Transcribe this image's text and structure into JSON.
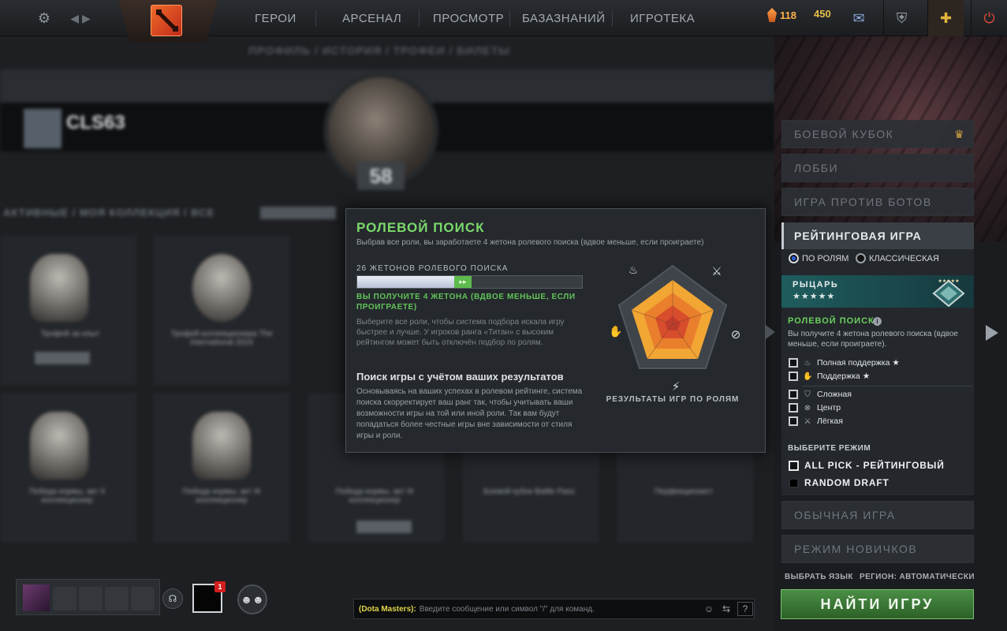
{
  "topbar": {
    "nav": [
      "ГЕРОИ",
      "АРСЕНАЛ",
      "ПРОСМОТР",
      "БАЗАЗНАНИЙ",
      "ИГРОТЕКА"
    ],
    "shards": "118",
    "gold": "450",
    "icons": [
      "gear-icon",
      "back-forward-icon",
      "dota-logo",
      "mail-icon",
      "armory-icon",
      "plus-icon",
      "power-icon"
    ]
  },
  "background": {
    "subnav": "ПРОФИЛЬ / ИСТОРИЯ / ТРОФЕИ / БИЛЕТЫ",
    "player_name": "CLS63",
    "level": "58",
    "filters": "АКТИВНЫЕ / МОЯ КОЛЛЕКЦИЯ / ВСЕ",
    "cards": [
      "Трофей за опыт",
      "Трофей коллекционера The International 2024",
      "Победа кормы, акт II коллекционер",
      "Победа кормы, акт III коллекционер",
      "Победа кормы, акт III коллекционер",
      "Боевой кубок Battle Pass",
      "Перфекционист"
    ]
  },
  "popup": {
    "title": "РОЛЕВОЙ ПОИСК",
    "subtitle": "Выбрав все роли, вы заработаете 4 жетона ролевого поиска (вдвое меньше, если проиграете)",
    "tokens_label": "26 ЖЕТОНОВ РОЛЕВОГО ПОИСКА",
    "progress_current": 0.43,
    "progress_gain": 0.08,
    "gain_text": "ВЫ ПОЛУЧИТЕ 4 ЖЕТОНА (ВДВОЕ МЕНЬШЕ, ЕСЛИ ПРОИГРАЕТЕ)",
    "desc": "Выберите все роли, чтобы система подбора искала игру быстрее и лучше. У игроков ранга «Титан» с высоким рейтингом может быть отключён подбор по ролям.",
    "heading2": "Поиск игры с учётом ваших результатов",
    "desc2": "Основываясь на ваших успехах в ролевом рейтинге, система поиска скорректирует ваш ранг так, чтобы учитывать ваши возможности игры на той или иной роли. Так вам будут попадаться более честные игры вне зависимости от стиля игры и роли.",
    "chart_label": "РЕЗУЛЬТАТЫ ИГР ПО РОЛЯМ",
    "chart_icons": [
      "hard-support-icon",
      "carry-icon",
      "offlane-icon",
      "mid-icon",
      "soft-support-icon"
    ]
  },
  "right_panel": {
    "btn_cup": "БОЕВОЙ КУБОК",
    "btn_lobby": "ЛОББИ",
    "btn_bots": "ИГРА ПРОТИВ БОТОВ",
    "ranked_title": "РЕЙТИНГОВАЯ ИГРА",
    "radio_roles": "ПО РОЛЯМ",
    "radio_classic": "КЛАССИЧЕСКАЯ",
    "rank_name": "РЫЦАРЬ",
    "rank_stars": "★★★★★",
    "role_search_title": "РОЛЕВОЙ ПОИСК",
    "role_search_desc": "Вы получите 4 жетона ролевого поиска (вдвое меньше, если проиграете).",
    "roles": [
      {
        "label": "Полная поддержка ★",
        "icon": "hard-support-icon"
      },
      {
        "label": "Поддержка ★",
        "icon": "soft-support-icon"
      },
      {
        "label": "Сложная",
        "icon": "offlane-icon"
      },
      {
        "label": "Центр",
        "icon": "mid-icon"
      },
      {
        "label": "Лёгкая",
        "icon": "carry-icon"
      }
    ],
    "mode_title": "ВЫБЕРИТЕ РЕЖИМ",
    "modes": [
      "ALL PICK - РЕЙТИНГОВЫЙ",
      "RANDOM DRAFT"
    ],
    "btn_normal": "ОБЫЧНАЯ ИГРА",
    "btn_newbie": "РЕЖИМ НОВИЧКОВ",
    "lang_link": "ВЫБРАТЬ ЯЗЫК",
    "region_link": "РЕГИОН: АВТОМАТИЧЕСКИ",
    "find_btn": "НАЙТИ ИГРУ"
  },
  "bottom": {
    "inbox_badge": "1",
    "chat_channel": "(Dota Masters):",
    "chat_placeholder": "Введите сообщение или символ \"/\" для команд.",
    "chat_help": "?"
  },
  "colors": {
    "accent_green": "#7bd96b",
    "find_button": "#3f7e3a",
    "gold": "#e8c04a",
    "shards": "#ff9a3a"
  }
}
